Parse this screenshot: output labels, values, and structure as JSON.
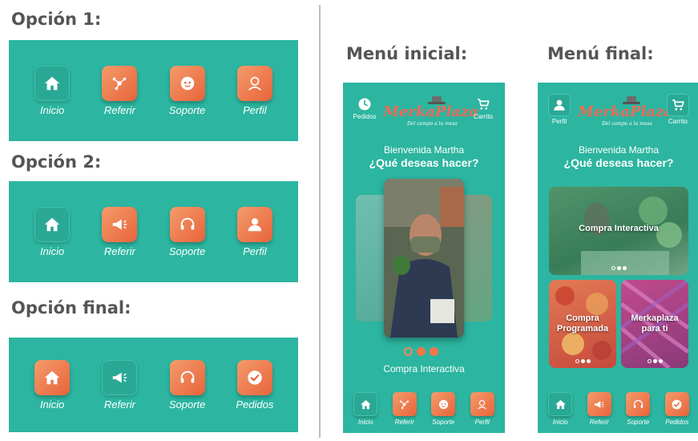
{
  "left": {
    "option1_title": "Opción 1:",
    "option2_title": "Opción 2:",
    "final_title": "Opción final:",
    "option1_items": [
      {
        "label": "Inicio",
        "icon": "home-icon",
        "active": false
      },
      {
        "label": "Referir",
        "icon": "network-icon",
        "active": true
      },
      {
        "label": "Soporte",
        "icon": "face-icon",
        "active": true
      },
      {
        "label": "Perfil",
        "icon": "user-outline-icon",
        "active": true
      }
    ],
    "option2_items": [
      {
        "label": "Inicio",
        "icon": "home-icon",
        "active": false
      },
      {
        "label": "Referir",
        "icon": "megaphone-icon",
        "active": true
      },
      {
        "label": "Soporte",
        "icon": "headset-icon",
        "active": true
      },
      {
        "label": "Perfil",
        "icon": "user-icon",
        "active": true
      }
    ],
    "final_items": [
      {
        "label": "Inicio",
        "icon": "home-icon",
        "active": true
      },
      {
        "label": "Referir",
        "icon": "megaphone-icon",
        "active": false
      },
      {
        "label": "Soporte",
        "icon": "headset-icon",
        "active": true
      },
      {
        "label": "Pedidos",
        "icon": "check-circle-icon",
        "active": true
      }
    ]
  },
  "menu_initial": {
    "title": "Menú inicial:",
    "header_left_label": "Pedidos",
    "header_right_label": "Carrito",
    "logo_text": "MerkaPlaza",
    "logo_tagline": "Del campo a la mesa",
    "greeting": "Bienvenida Martha",
    "question": "¿Qué deseas hacer?",
    "carousel_caption": "Compra Interactiva",
    "bottom_nav": [
      {
        "label": "Inicio",
        "icon": "home-icon",
        "active": false
      },
      {
        "label": "Referir",
        "icon": "network-icon",
        "active": true
      },
      {
        "label": "Soporte",
        "icon": "face-icon",
        "active": true
      },
      {
        "label": "Perfil",
        "icon": "user-outline-icon",
        "active": true
      }
    ]
  },
  "menu_final": {
    "title": "Menú final:",
    "header_left_label": "Perfil",
    "header_right_label": "Carrito",
    "logo_text": "MerkaPlaza",
    "logo_tagline": "Del campo a la mesa",
    "greeting": "Bienvenida Martha",
    "question": "¿Qué deseas hacer?",
    "card_interactive": "Compra Interactiva",
    "card_programmed_1": "Compra",
    "card_programmed_2": "Programada",
    "card_merka_1": "Merkaplaza",
    "card_merka_2": "para ti",
    "bottom_nav": [
      {
        "label": "Inicio",
        "icon": "home-icon",
        "active": false
      },
      {
        "label": "Referir",
        "icon": "megaphone-icon",
        "active": true
      },
      {
        "label": "Soporte",
        "icon": "headset-icon",
        "active": true
      },
      {
        "label": "Pedidos",
        "icon": "check-circle-icon",
        "active": true
      }
    ]
  },
  "colors": {
    "teal": "#2cb5a0",
    "orange": "#ee7046",
    "text_gray": "#555555"
  }
}
